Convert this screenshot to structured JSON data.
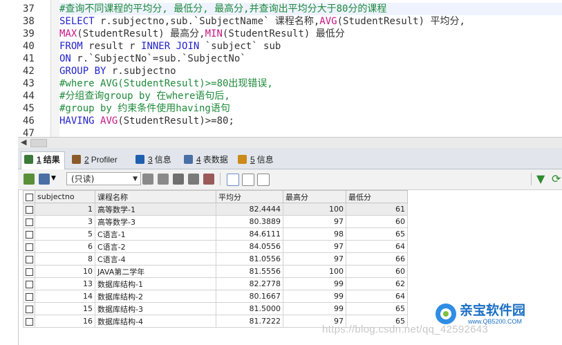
{
  "editor": {
    "top_cut_text": "…(((((((((((((((((",
    "lines": [
      {
        "n": "37",
        "parts": [
          {
            "t": "#查询不同课程的平均分, 最低分, 最高分,并查询出平均分大于80分的课程",
            "c": "cm"
          }
        ]
      },
      {
        "n": "38",
        "parts": [
          {
            "t": "SELECT",
            "c": "kw"
          },
          {
            "t": " r.subjectno,sub.`SubjectName` 课程名称,",
            "c": ""
          },
          {
            "t": "AVG",
            "c": "fn"
          },
          {
            "t": "(StudentResult) 平均分,",
            "c": ""
          }
        ]
      },
      {
        "n": "39",
        "parts": [
          {
            "t": "MAX",
            "c": "fn"
          },
          {
            "t": "(StudentResult) 最高分,",
            "c": ""
          },
          {
            "t": "MIN",
            "c": "fn"
          },
          {
            "t": "(StudentResult) 最低分",
            "c": ""
          }
        ]
      },
      {
        "n": "40",
        "parts": [
          {
            "t": "FROM",
            "c": "kw"
          },
          {
            "t": " result r ",
            "c": ""
          },
          {
            "t": "INNER JOIN",
            "c": "kw"
          },
          {
            "t": " `subject` sub",
            "c": ""
          }
        ]
      },
      {
        "n": "41",
        "parts": [
          {
            "t": "ON",
            "c": "kw"
          },
          {
            "t": " r.`SubjectNo`=sub.`SubjectNo`",
            "c": ""
          }
        ]
      },
      {
        "n": "42",
        "parts": [
          {
            "t": "GROUP BY",
            "c": "kw"
          },
          {
            "t": " r.subjectno",
            "c": ""
          }
        ]
      },
      {
        "n": "43",
        "parts": [
          {
            "t": "#where AVG(StudentResult)>=80出现错误,",
            "c": "cm"
          }
        ]
      },
      {
        "n": "44",
        "parts": [
          {
            "t": "#分组查询group by 在where语句后,",
            "c": "cm"
          }
        ]
      },
      {
        "n": "45",
        "parts": [
          {
            "t": "#group by 约束条件使用having语句",
            "c": "cm"
          }
        ]
      },
      {
        "n": "46",
        "parts": [
          {
            "t": "HAVING",
            "c": "kw"
          },
          {
            "t": " ",
            "c": ""
          },
          {
            "t": "AVG",
            "c": "fn"
          },
          {
            "t": "(StudentResult)>=80;",
            "c": ""
          }
        ]
      },
      {
        "n": "47",
        "parts": []
      }
    ]
  },
  "tabs": [
    {
      "num": "1",
      "label": "结果",
      "icon_color": "#3a7a3a",
      "active": true
    },
    {
      "num": "2",
      "label": "Profiler",
      "icon_color": "#8a5a2a",
      "active": false
    },
    {
      "num": "3",
      "label": "信息",
      "icon_color": "#1f5fb0",
      "active": false
    },
    {
      "num": "4",
      "label": "表数据",
      "icon_color": "#4a6fa5",
      "active": false
    },
    {
      "num": "5",
      "label": "信息",
      "icon_color": "#cc8a1a",
      "active": false
    }
  ],
  "toolbar": {
    "readonly_label": "(只读)",
    "filter_icon": "filter-icon",
    "refresh_icon": "refresh-icon"
  },
  "grid": {
    "columns": [
      "subjectno",
      "课程名称",
      "平均分",
      "最高分",
      "最低分"
    ],
    "rows": [
      [
        "1",
        "高等数学-1",
        "82.4444",
        "100",
        "61"
      ],
      [
        "3",
        "高等数学-3",
        "80.3889",
        "97",
        "60"
      ],
      [
        "5",
        "C语言-1",
        "84.6111",
        "98",
        "65"
      ],
      [
        "6",
        "C语言-2",
        "84.0556",
        "97",
        "64"
      ],
      [
        "8",
        "C语言-4",
        "81.0556",
        "97",
        "66"
      ],
      [
        "10",
        "JAVA第二学年",
        "81.5556",
        "100",
        "60"
      ],
      [
        "13",
        "数据库结构-1",
        "82.2778",
        "99",
        "62"
      ],
      [
        "14",
        "数据库结构-2",
        "80.1667",
        "99",
        "64"
      ],
      [
        "15",
        "数据库结构-3",
        "81.5000",
        "99",
        "65"
      ],
      [
        "16",
        "数据库结构-4",
        "81.7222",
        "97",
        "65"
      ]
    ]
  },
  "watermark": "https://blog.csdn.net/qq_42592643",
  "logo": {
    "brand": "亲宝软件园",
    "url": "www.QB5200.COM"
  }
}
